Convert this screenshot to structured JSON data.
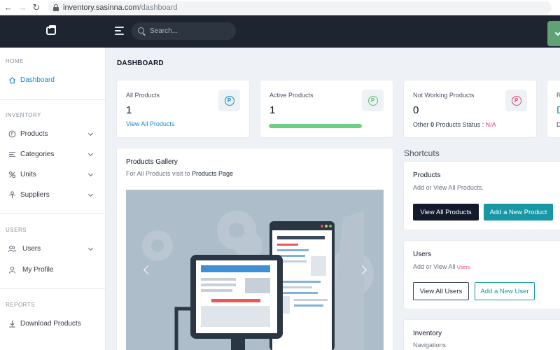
{
  "browser": {
    "url_host": "inventory.sasinna.com",
    "url_path": "/dashboard"
  },
  "header": {
    "search_placeholder": "Search..."
  },
  "sidebar": {
    "sections": [
      {
        "heading": "HOME",
        "items": [
          {
            "label": "Dashboard",
            "icon": "home-icon",
            "active": true
          }
        ]
      },
      {
        "heading": "INVENTORY",
        "items": [
          {
            "label": "Products",
            "icon": "product-icon"
          },
          {
            "label": "Categories",
            "icon": "categories-icon"
          },
          {
            "label": "Units",
            "icon": "units-icon"
          },
          {
            "label": "Suppliers",
            "icon": "supplier-icon"
          }
        ]
      },
      {
        "heading": "USERS",
        "items": [
          {
            "label": "Users",
            "icon": "users-icon"
          },
          {
            "label": "My Profile",
            "icon": "profile-icon"
          }
        ]
      },
      {
        "heading": "REPORTS",
        "items": [
          {
            "label": "Download Products",
            "icon": "download-icon"
          }
        ]
      }
    ]
  },
  "main": {
    "page_title": "DASHBOARD",
    "stats": [
      {
        "label": "All Products",
        "value": "1",
        "link": "View All Products",
        "icon_color": "#1789c9"
      },
      {
        "label": "Active Products",
        "value": "1",
        "progress": 1.0,
        "icon_color": "#5bc26f"
      },
      {
        "label": "Not Working Products",
        "value": "0",
        "sub_prefix": "Other ",
        "sub_count": "0",
        "sub_mid": " Products Status : ",
        "sub_status": "N/A",
        "icon_color": "#e24b73"
      },
      {
        "label": "R",
        "value": "D",
        "sub": "D"
      }
    ],
    "gallery": {
      "title": "Products Gallery",
      "subtitle_prefix": "For All Products visit to ",
      "subtitle_link": "Products Page"
    },
    "shortcuts": {
      "title": "Shortcuts",
      "cards": [
        {
          "title": "Products",
          "subtitle": "Add or View All Products.",
          "buttons": [
            "View All Products",
            "Add a New Product"
          ]
        },
        {
          "title": "Users",
          "subtitle_prefix": "Add or View All ",
          "subtitle_tag": "Users.",
          "buttons": [
            "View All Users",
            "Add a New User"
          ]
        },
        {
          "title": "Inventory",
          "subtitle": "Navigations"
        }
      ]
    }
  }
}
